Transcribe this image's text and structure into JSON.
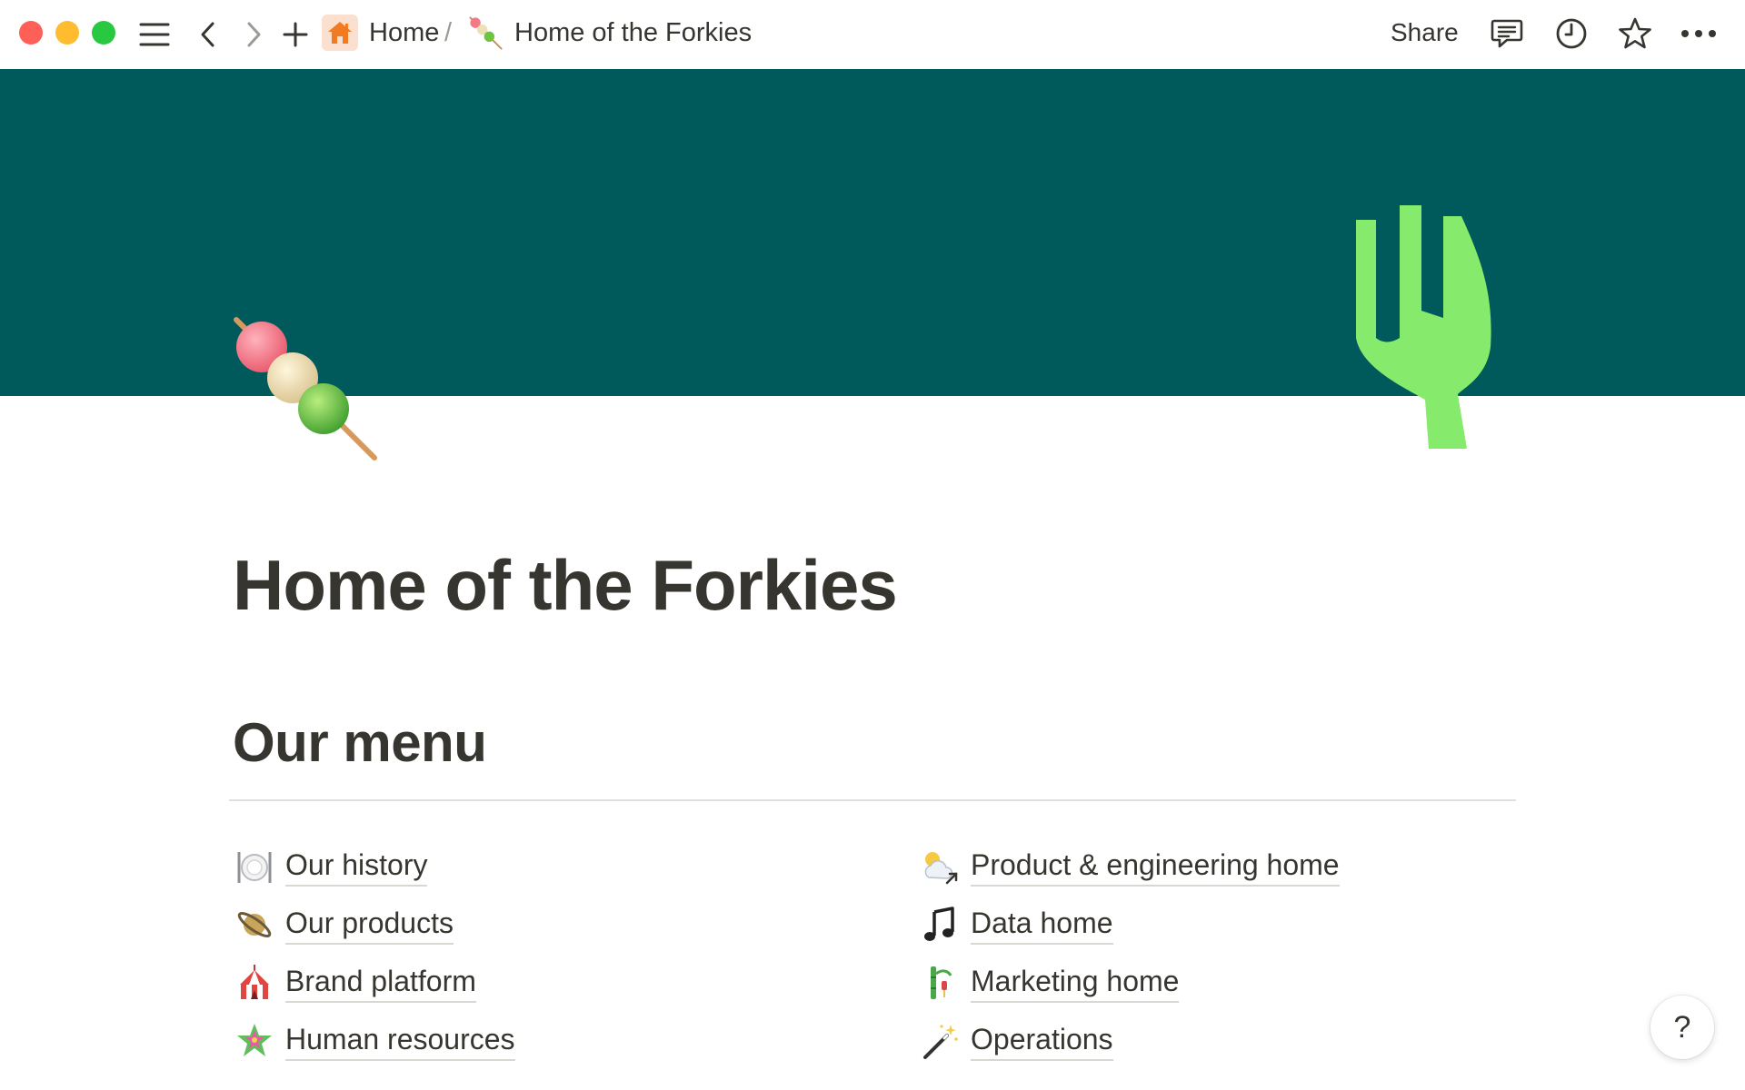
{
  "topbar": {
    "breadcrumb": {
      "home_label": "Home",
      "separator": "/",
      "page_label": "Home of the Forkies"
    },
    "share_label": "Share",
    "icons": [
      "sidebar-menu-icon",
      "back-icon",
      "forward-icon",
      "plus-icon",
      "house-icon",
      "dango-icon",
      "comment-icon",
      "clock-icon",
      "star-icon",
      "more-icon"
    ]
  },
  "colors": {
    "cover": "#005a5b",
    "fork": "#86ea6c",
    "home_icon_bg": "#fbdfcf",
    "home_icon": "#f27b22",
    "text": "#37352f"
  },
  "page": {
    "title": "Home of the Forkies",
    "section_heading": "Our menu"
  },
  "menu": {
    "left": [
      {
        "label": "Our history",
        "icon": "plate-icon"
      },
      {
        "label": "Our products",
        "icon": "planet-icon"
      },
      {
        "label": "Brand platform",
        "icon": "circus-tent-icon"
      },
      {
        "label": "Human resources",
        "icon": "pinata-icon"
      }
    ],
    "right": [
      {
        "label": "Product & engineering home",
        "icon": "sun-cloud-icon"
      },
      {
        "label": "Data home",
        "icon": "music-note-icon"
      },
      {
        "label": "Marketing home",
        "icon": "bamboo-icon"
      },
      {
        "label": "Operations",
        "icon": "magic-wand-icon"
      }
    ]
  },
  "help_label": "?"
}
